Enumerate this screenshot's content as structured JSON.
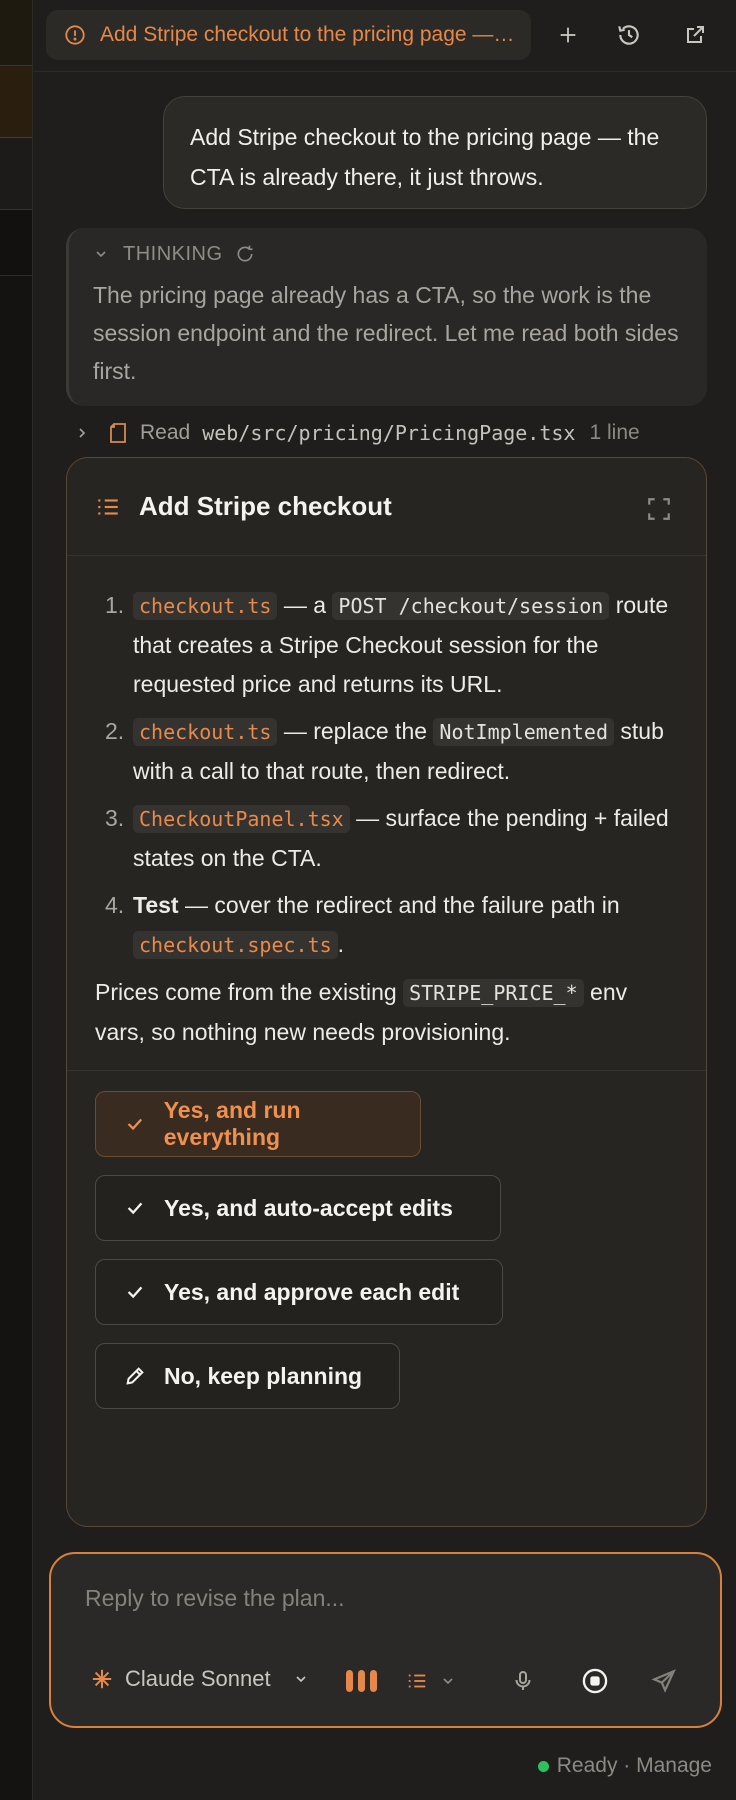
{
  "tab": {
    "title": "Add Stripe checkout to the pricing page — the CTA is already there, it just throws."
  },
  "user_message": "Add Stripe checkout to the pricing page — the CTA is already there, it just throws.",
  "thinking": {
    "label": "THINKING",
    "text": "The pricing page already has a CTA, so the work is the session endpoint and the redirect. Let me read both sides first."
  },
  "read": {
    "verb": "Read",
    "path": "web/src/pricing/PricingPage.tsx",
    "count": "1 line"
  },
  "plan": {
    "title": "Add Stripe checkout",
    "steps": [
      {
        "num": "1.",
        "code": "checkout.ts",
        "t1": " — a ",
        "code2": "POST /checkout/session",
        "t2": " route that creates a Stripe Checkout session for the requested price and returns its URL."
      },
      {
        "num": "2.",
        "code": "checkout.ts",
        "t1": " — replace the ",
        "code2": "NotImplemented",
        "t2": " stub with a call to that route, then redirect."
      },
      {
        "num": "3.",
        "code": "CheckoutPanel.tsx",
        "t1": " — surface the pending + failed states on the CTA."
      },
      {
        "num": "4.",
        "bold": "Test",
        "t1": " — cover the redirect and the failure path in ",
        "code": "checkout.spec.ts",
        "t2": "."
      }
    ],
    "note_before": "Prices come from the existing ",
    "note_code": "STRIPE_PRICE_*",
    "note_after": " env vars, so nothing new needs provisioning."
  },
  "options": [
    {
      "label": "Yes, and run everything",
      "icon": "check-icon"
    },
    {
      "label": "Yes, and auto-accept edits",
      "icon": "check-icon"
    },
    {
      "label": "Yes, and approve each edit",
      "icon": "check-icon"
    },
    {
      "label": "No, keep planning",
      "icon": "pencil-icon"
    }
  ],
  "composer": {
    "placeholder": "Reply to revise the plan...",
    "model": "Claude Sonnet"
  },
  "status": {
    "text": "Ready · Manage"
  },
  "colors": {
    "accent": "#e5884a",
    "ready": "#2fbf61"
  }
}
